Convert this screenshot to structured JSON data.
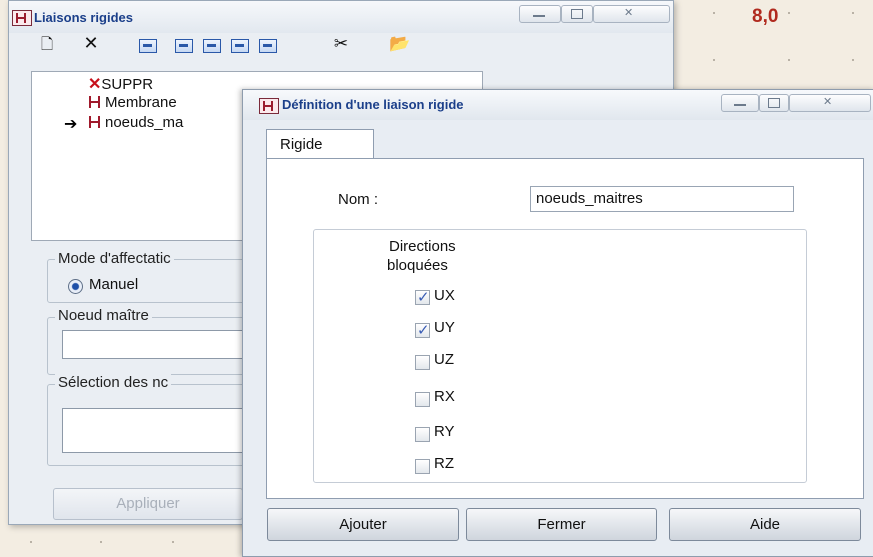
{
  "background": {
    "value": "8,0"
  },
  "back_window": {
    "title": "Liaisons rigides",
    "tree_items": [
      "SUPPR",
      "Membrane",
      "noeuds_ma"
    ],
    "mode_group_label": "Mode d'affectatic",
    "mode_option": "Manuel",
    "master_node_label": "Noeud maître",
    "selection_label": "Sélection des nc",
    "apply_button": "Appliquer"
  },
  "dialog": {
    "title": "Définition d'une liaison rigide",
    "tab_label": "Rigide",
    "name_label": "Nom :",
    "name_value": "noeuds_maitres",
    "directions_label_line1": "Directions",
    "directions_label_line2": "bloquées",
    "directions": [
      {
        "label": "UX",
        "checked": true
      },
      {
        "label": "UY",
        "checked": true
      },
      {
        "label": "UZ",
        "checked": false
      },
      {
        "label": "RX",
        "checked": false
      },
      {
        "label": "RY",
        "checked": false
      },
      {
        "label": "RZ",
        "checked": false
      }
    ],
    "buttons": {
      "add": "Ajouter",
      "close": "Fermer",
      "help": "Aide"
    }
  },
  "colors": {
    "title_blue": "#1b3f8a",
    "icon_red": "#a01a2c",
    "background": "#f3ede2"
  }
}
